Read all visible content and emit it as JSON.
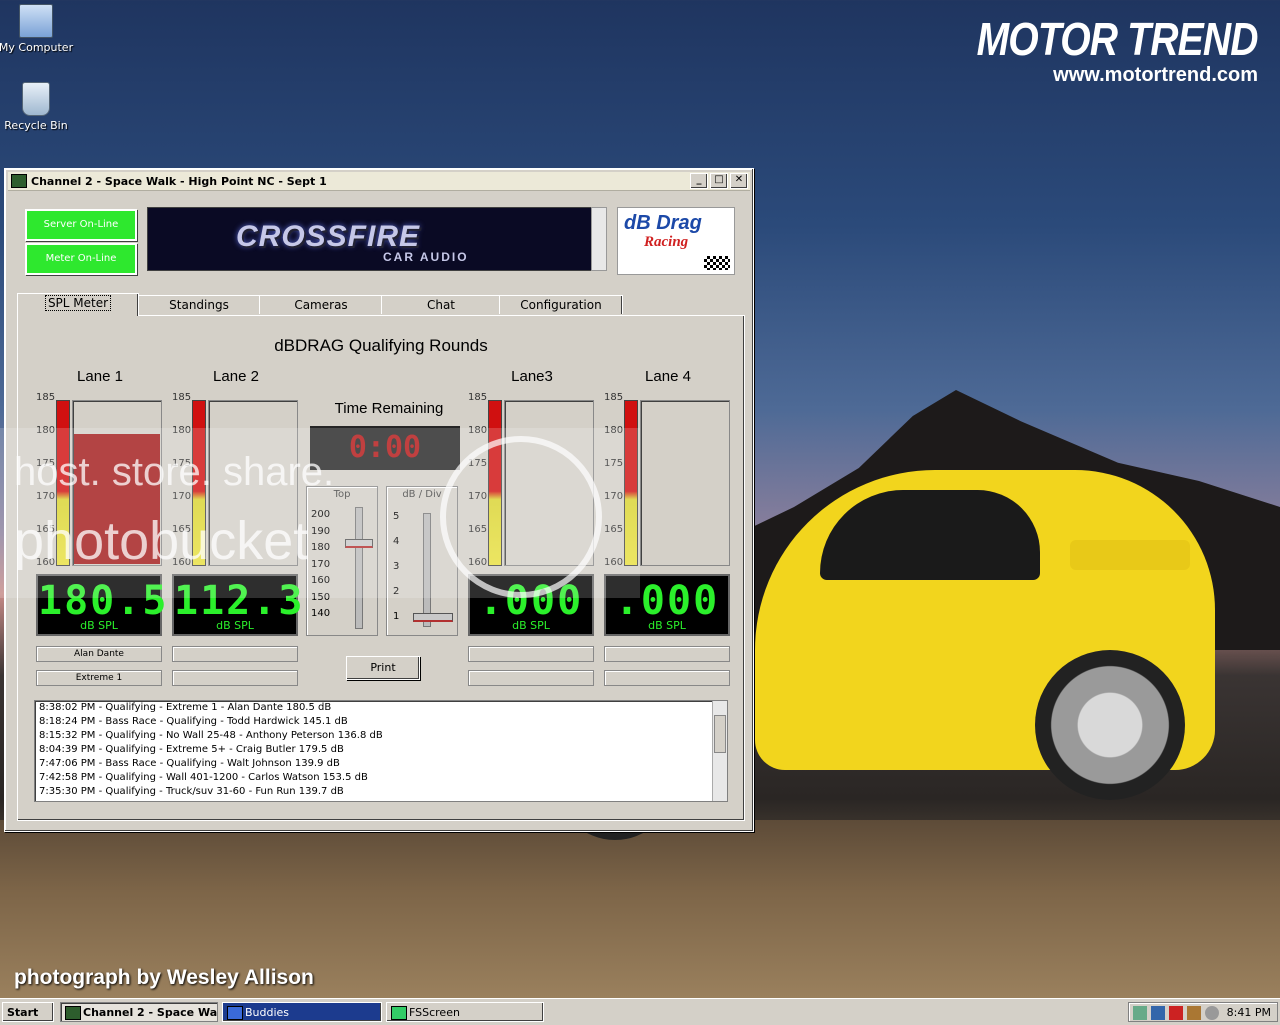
{
  "desktop": {
    "icons": [
      {
        "label": "My Computer"
      },
      {
        "label": "Recycle Bin"
      }
    ],
    "brand": {
      "title": "MOTOR TREND",
      "url": "www.motortrend.com"
    },
    "credit": "photograph by Wesley Allison",
    "watermark": {
      "line1": "host. store. share.",
      "line2": "photobucket"
    }
  },
  "window": {
    "title": "Channel 2 - Space Walk - High Point NC - Sept 1",
    "controls": {
      "minimize": "_",
      "maximize": "□",
      "close": "✕"
    },
    "status": {
      "server": "Server On-Line",
      "meter": "Meter On-Line"
    },
    "banner": {
      "brand": "CROSSFIRE",
      "sub": "CAR AUDIO"
    },
    "logo": {
      "line1": "dB Drag",
      "line2": "Racing"
    },
    "tabs": [
      {
        "label": "SPL Meter",
        "active": true
      },
      {
        "label": "Standings"
      },
      {
        "label": "Cameras"
      },
      {
        "label": "Chat"
      },
      {
        "label": "Configuration"
      }
    ],
    "meter": {
      "heading": "dBDRAG Qualifying Rounds",
      "scale": [
        "185",
        "180",
        "175",
        "170",
        "165",
        "160"
      ],
      "lanes": [
        {
          "title": "Lane 1",
          "value": "180.5",
          "unit": "dB SPL",
          "name": "Alan Dante",
          "class": "Extreme 1",
          "level": 0.8
        },
        {
          "title": "Lane 2",
          "value": "112.3",
          "unit": "dB SPL",
          "name": "",
          "class": "",
          "level": 0
        },
        {
          "title": "Lane3",
          "value": ".000",
          "unit": "dB SPL",
          "name": "",
          "class": "",
          "level": 0
        },
        {
          "title": "Lane 4",
          "value": ".000",
          "unit": "dB SPL",
          "name": "",
          "class": "",
          "level": 0
        }
      ],
      "time_label": "Time Remaining",
      "time_value": "0:00",
      "top_control": {
        "label": "Top",
        "ticks": [
          "200",
          "190",
          "180",
          "170",
          "160",
          "150",
          "140"
        ],
        "value": "185"
      },
      "div_control": {
        "label": "dB / Div",
        "ticks": [
          "5",
          "4",
          "3",
          "2",
          "1"
        ],
        "value": "1"
      },
      "print_label": "Print"
    },
    "log": [
      "8:38:02 PM - Qualifying - Extreme 1 - Alan Dante 180.5 dB",
      "8:18:24 PM - Bass Race - Qualifying - Todd Hardwick 145.1 dB",
      "8:15:32 PM - Qualifying - No Wall 25-48 - Anthony Peterson 136.8 dB",
      "8:04:39 PM - Qualifying - Extreme 5+ - Craig Butler 179.5 dB",
      "7:47:06 PM - Bass Race - Qualifying - Walt Johnson 139.9 dB",
      "7:42:58 PM - Qualifying - Wall 401-1200 - Carlos Watson 153.5 dB",
      "7:35:30 PM - Qualifying - Truck/suv 31-60 - Fun Run 139.7 dB"
    ]
  },
  "taskbar": {
    "start": "Start",
    "items": [
      {
        "label": "Channel 2 - Space Wa...",
        "active": true
      },
      {
        "label": "Buddies"
      },
      {
        "label": "FSScreen"
      }
    ],
    "clock": "8:41 PM"
  },
  "colors": {
    "lcd_text": "#2bf02b",
    "status_green": "#2ee82e",
    "meter_red": "#a31b1b",
    "timer_red": "#b21616"
  }
}
